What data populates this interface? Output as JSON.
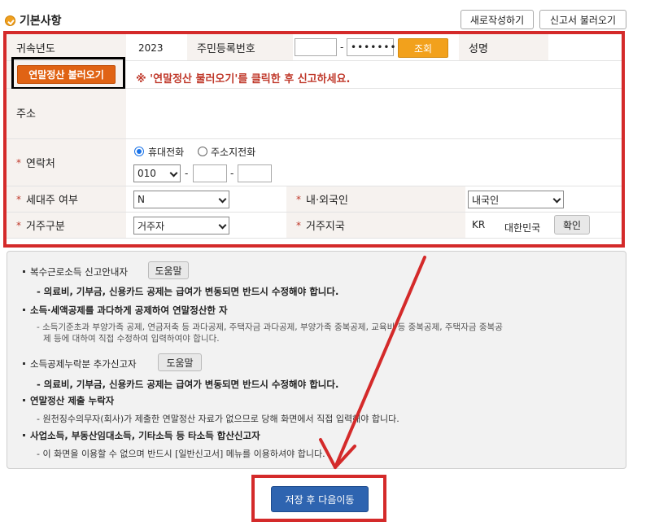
{
  "section_title": "기본사항",
  "header_buttons": {
    "new": "새로작성하기",
    "load_report": "신고서 불러오기"
  },
  "form": {
    "year_label": "귀속년도",
    "year_value": "2023",
    "ssn_label": "주민등록번호",
    "ssn_sep": "-",
    "ssn_back": "•••••••",
    "lookup_button": "조회",
    "name_label": "성명",
    "load_settlement_button": "연말정산 불러오기",
    "notice": "※ '연말정산 불러오기'를 클릭한 후 신고하세요.",
    "address_label": "주소",
    "contact_label": "연락처",
    "radio_mobile": "휴대전화",
    "radio_home": "주소지전화",
    "phone_prefix": "010",
    "phone_sep": "-",
    "householder_label": "세대주 여부",
    "householder_value": "N",
    "nationality_label": "내·외국인",
    "nationality_value": "내국인",
    "residence_label": "거주구분",
    "residence_value": "거주자",
    "country_label": "거주지국",
    "country_code": "KR",
    "country_name": "대한민국",
    "confirm_button": "확인"
  },
  "info": {
    "item1": "복수근로소득 신고안내자",
    "help_button": "도움말",
    "item1_sub": "- 의료비, 기부금, 신용카드 공제는 급여가 변동되면 반드시 수정해야 합니다.",
    "item2": "소득·세액공제를 과다하게 공제하여 연말정산한 자",
    "item2_sub1": "- 소득기준초과 부양가족 공제, 연금저축 등 과다공제, 주택자금 과다공제, 부양가족 중복공제, 교육비 등 중복공제, 주택자금 중복공",
    "item2_sub2": "제 등에 대하여 직접 수정하여 입력하여야 합니다.",
    "item3": "소득공제누락분 추가신고자",
    "item3_sub": "- 의료비, 기부금, 신용카드 공제는 급여가 변동되면 반드시 수정해야 합니다.",
    "item4": "연말정산 제출 누락자",
    "item4_sub": "- 원천징수의무자(회사)가 제출한 연말정산 자료가 없으므로 당해 화면에서 직접 입력해야 합니다.",
    "item5": "사업소득, 부동산임대소득, 기타소득 등 타소득 합산신고자",
    "item5_sub": "- 이 화면을 이용할 수 없으며 반드시 [일반신고서] 메뉴를 이용하셔야 합니다."
  },
  "save_button": "저장 후 다음이동",
  "colors": {
    "annotation_red": "#d42a2a",
    "accent_orange": "#f2a11c",
    "save_blue": "#2e64b0"
  }
}
